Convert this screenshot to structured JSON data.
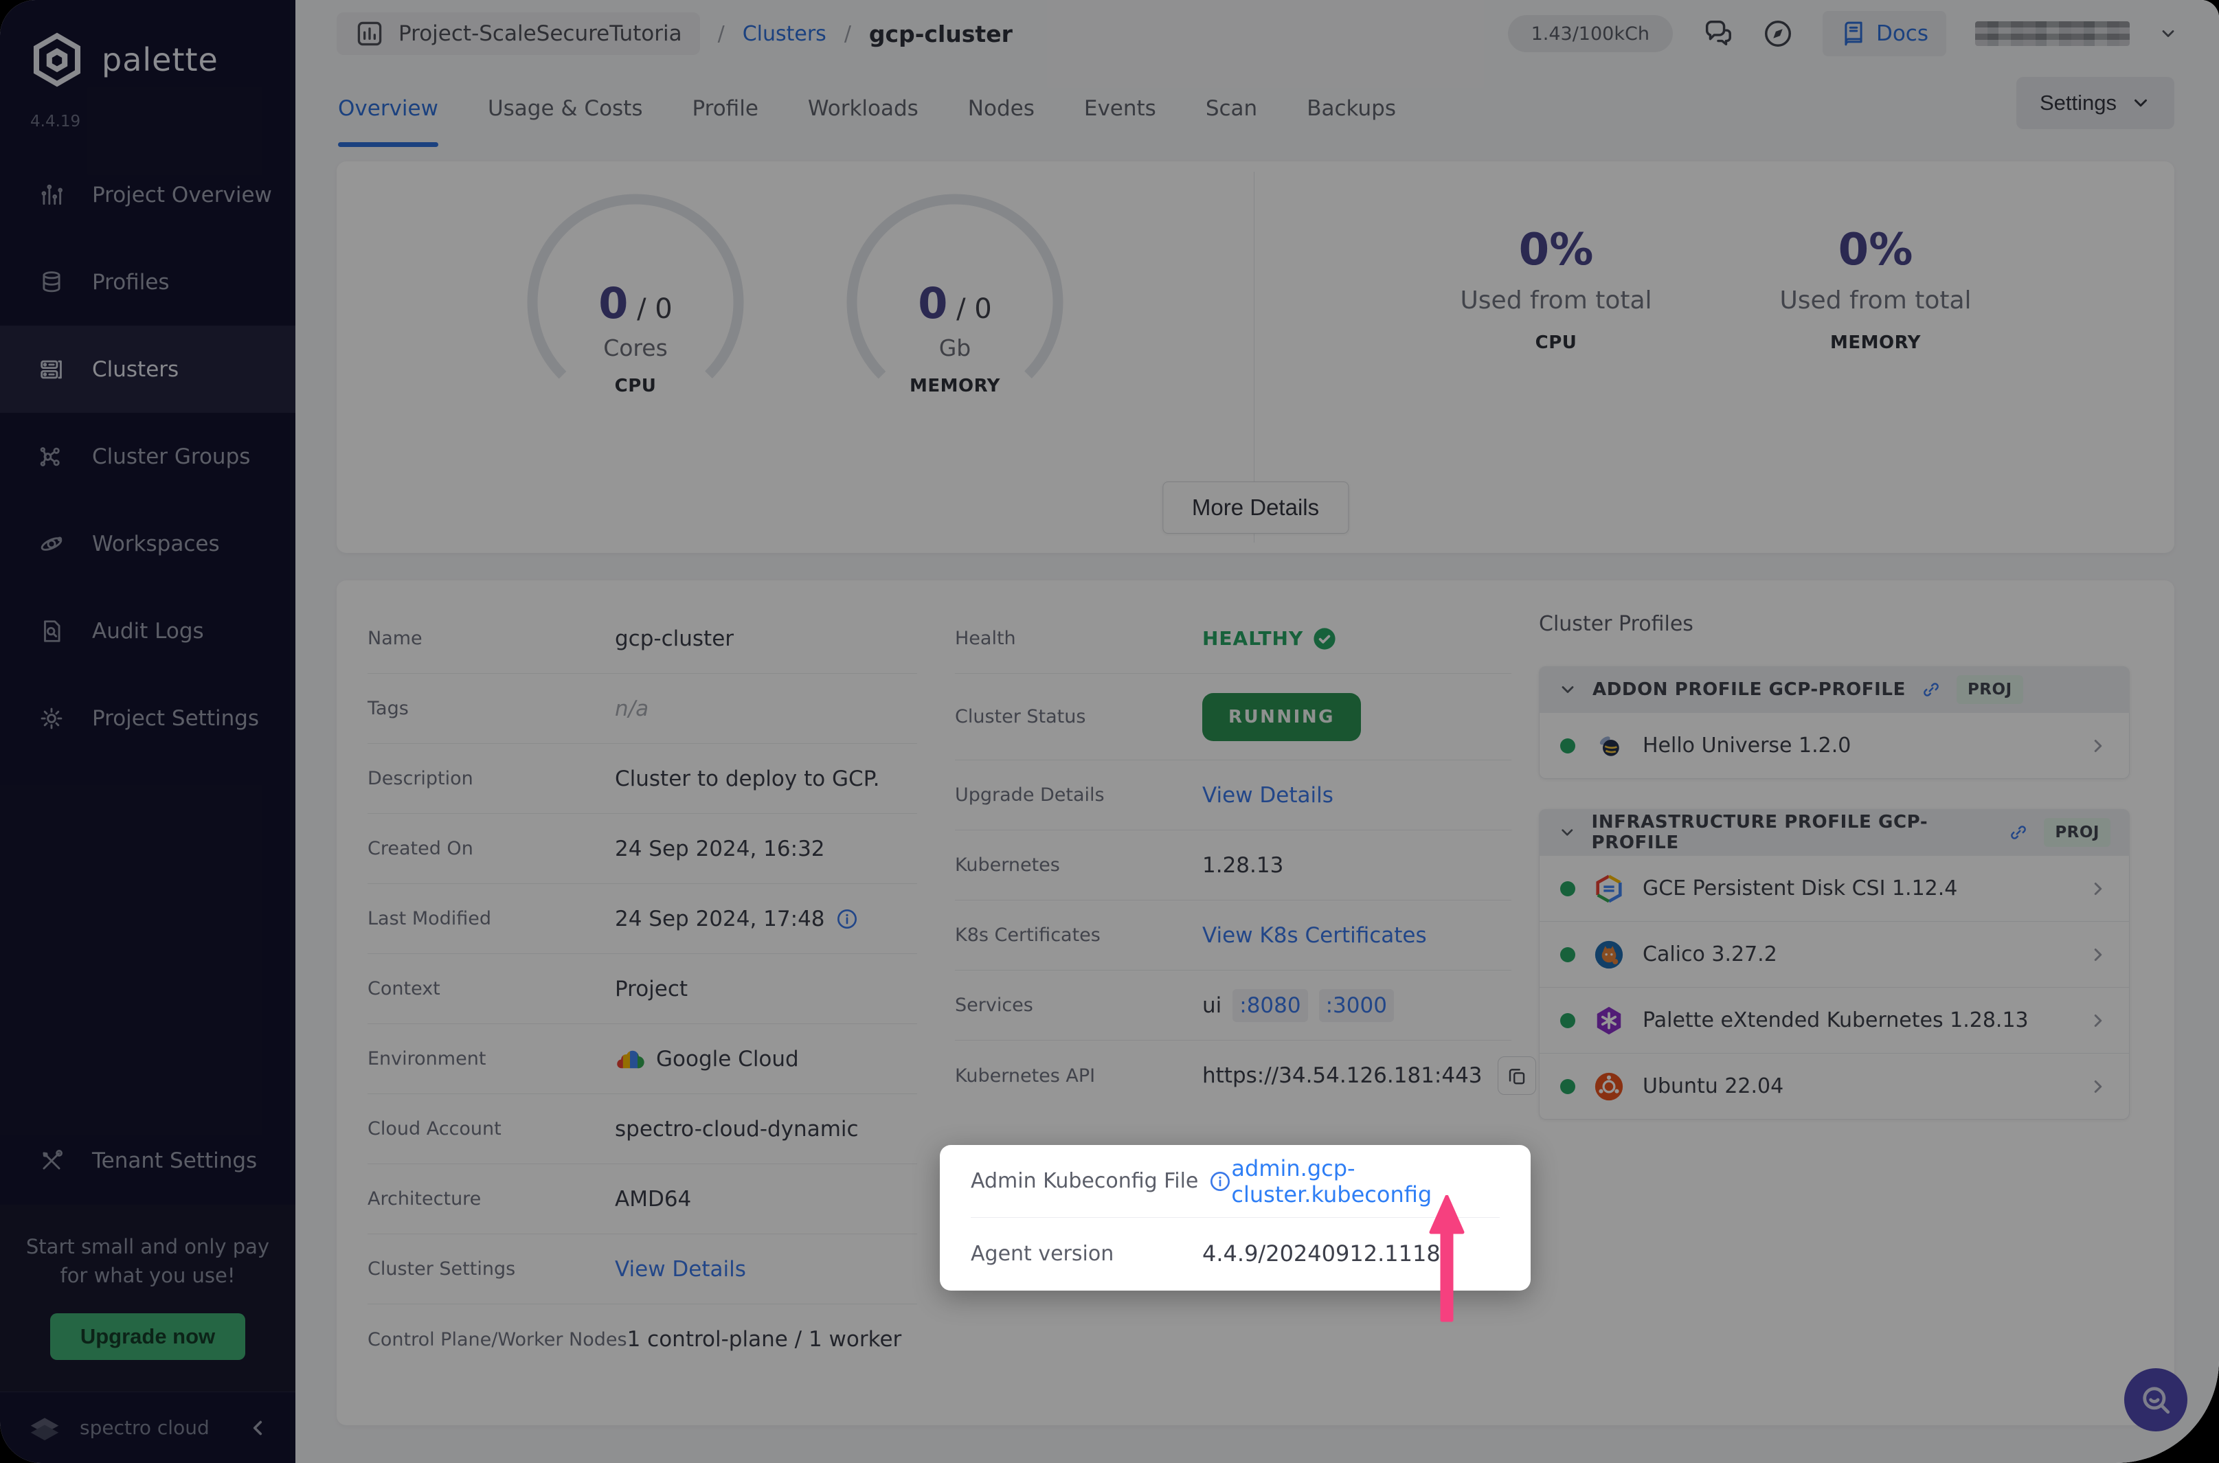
{
  "header": {
    "project": "Project-ScaleSecureTutoria",
    "separator": "/",
    "breadcrumb_clusters": "Clusters",
    "breadcrumb_current": "gcp-cluster",
    "credits": "1.43/100kCh",
    "docs": "Docs",
    "settings": "Settings"
  },
  "tabs": [
    {
      "label": "Overview"
    },
    {
      "label": "Usage & Costs"
    },
    {
      "label": "Profile"
    },
    {
      "label": "Workloads"
    },
    {
      "label": "Nodes"
    },
    {
      "label": "Events"
    },
    {
      "label": "Scan"
    },
    {
      "label": "Backups"
    }
  ],
  "sidebar": {
    "brand": "palette",
    "version": "4.4.19",
    "items": [
      {
        "label": "Project Overview"
      },
      {
        "label": "Profiles"
      },
      {
        "label": "Clusters"
      },
      {
        "label": "Cluster Groups"
      },
      {
        "label": "Workspaces"
      },
      {
        "label": "Audit Logs"
      },
      {
        "label": "Project Settings"
      }
    ],
    "tenant_settings": "Tenant Settings",
    "promo_line1": "Start small and only pay",
    "promo_line2": "for what you use!",
    "upgrade_button": "Upgrade now",
    "footer_brand": "spectro cloud"
  },
  "overview": {
    "cpu": {
      "used": "0",
      "sep": "/",
      "total": "0",
      "unit": "Cores",
      "caption": "CPU"
    },
    "memory": {
      "used": "0",
      "sep": "/",
      "total": "0",
      "unit": "Gb",
      "caption": "MEMORY"
    },
    "cpu_usage": {
      "value": "0%",
      "label": "Used from total",
      "caption": "CPU"
    },
    "memory_usage": {
      "value": "0%",
      "label": "Used from total",
      "caption": "MEMORY"
    },
    "more_details": "More Details"
  },
  "details": {
    "left": {
      "name": {
        "label": "Name",
        "value": "gcp-cluster"
      },
      "tags": {
        "label": "Tags",
        "value": "n/a"
      },
      "description": {
        "label": "Description",
        "value": "Cluster to deploy to GCP."
      },
      "created_on": {
        "label": "Created On",
        "value": "24 Sep 2024, 16:32"
      },
      "last_modified": {
        "label": "Last Modified",
        "value": "24 Sep 2024, 17:48"
      },
      "context": {
        "label": "Context",
        "value": "Project"
      },
      "environment": {
        "label": "Environment",
        "value": "Google Cloud"
      },
      "cloud_account": {
        "label": "Cloud Account",
        "value": "spectro-cloud-dynamic"
      },
      "architecture": {
        "label": "Architecture",
        "value": "AMD64"
      },
      "cluster_settings": {
        "label": "Cluster Settings",
        "value": "View Details"
      },
      "nodes": {
        "label": "Control Plane/Worker Nodes",
        "value": "1 control-plane / 1 worker"
      }
    },
    "middle": {
      "health": {
        "label": "Health",
        "value": "HEALTHY"
      },
      "status": {
        "label": "Cluster Status",
        "value": "RUNNING"
      },
      "upgrade": {
        "label": "Upgrade Details",
        "value": "View Details"
      },
      "kubernetes": {
        "label": "Kubernetes",
        "value": "1.28.13"
      },
      "certs": {
        "label": "K8s Certificates",
        "value": "View K8s Certificates"
      },
      "services": {
        "label": "Services",
        "prefix": "ui",
        "port1": ":8080",
        "port2": ":3000"
      },
      "api": {
        "label": "Kubernetes API",
        "value": "https://34.54.126.181:443"
      }
    }
  },
  "spotlight": {
    "kubeconfig_label": "Admin Kubeconfig File",
    "kubeconfig_value": "admin.gcp-cluster.kubeconfig",
    "agent_label": "Agent version",
    "agent_value": "4.4.9/20240912.1118"
  },
  "profiles": {
    "title": "Cluster Profiles",
    "addon": {
      "header": "ADDON PROFILE GCP-PROFILE",
      "badge": "PROJ"
    },
    "infra": {
      "header": "INFRASTRUCTURE PROFILE GCP-PROFILE",
      "badge": "PROJ"
    },
    "items": {
      "hello": "Hello Universe 1.2.0",
      "gce": "GCE Persistent Disk CSI 1.12.4",
      "calico": "Calico 3.27.2",
      "pxk": "Palette eXtended Kubernetes 1.28.13",
      "ubuntu": "Ubuntu 22.04"
    }
  },
  "colors": {
    "accent_blue": "#2e6fd8",
    "link_blue": "#2e7ef5",
    "healthy_green": "#27a665",
    "running_green": "#2b9153",
    "badge_green_bg": "#dff0e6",
    "arrow_pink": "#f6407f",
    "indigo": "#49478b",
    "upgrade_green": "#3fae74",
    "sidebar_bg": "#14142e",
    "fab_purple": "#514ab2"
  }
}
